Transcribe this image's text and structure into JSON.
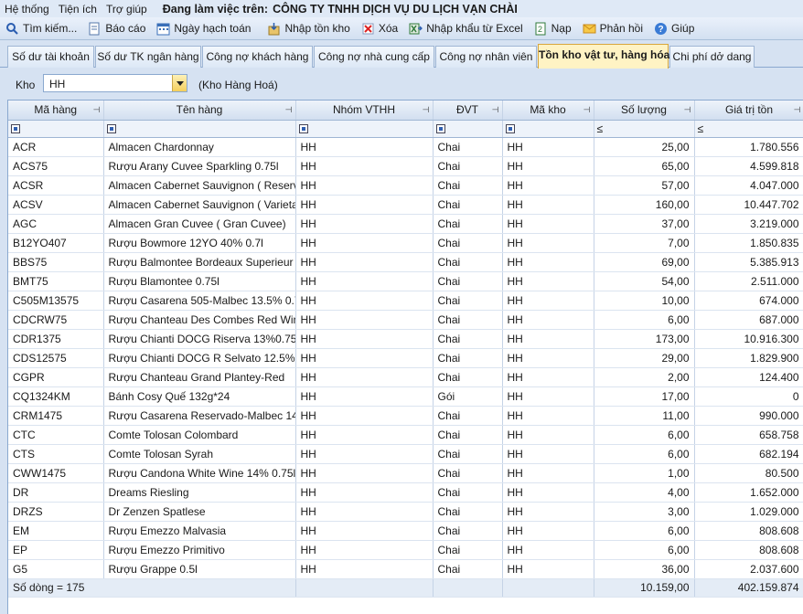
{
  "menu": [
    "Hệ thống",
    "Tiện ích",
    "Trợ giúp"
  ],
  "workspace_label": "Đang làm việc trên:",
  "company_name": "CÔNG TY TNHH DỊCH VỤ DU LỊCH VẠN CHÀI",
  "toolbar": {
    "search": "Tìm kiếm...",
    "report": "Báo cáo",
    "accounting_date": "Ngày hạch toán",
    "import_stock": "Nhập tồn kho",
    "delete": "Xóa",
    "import_excel": "Nhập khẩu từ Excel",
    "load": "Nạp",
    "feedback": "Phản hồi",
    "help": "Giúp"
  },
  "tabs": [
    "Số dư tài khoản",
    "Số dư TK ngân hàng",
    "Công nợ khách hàng",
    "Công nợ nhà cung cấp",
    "Công nợ nhân viên",
    "Tồn kho vật tư, hàng hóa",
    "Chi phí dở dang"
  ],
  "active_tab": 5,
  "filter": {
    "label": "Kho",
    "value": "HH",
    "description": "(Kho Hàng Hoá)"
  },
  "columns": [
    "Mã hàng",
    "Tên hàng",
    "Nhóm VTHH",
    "ĐVT",
    "Mã kho",
    "Số lượng",
    "Giá trị tồn"
  ],
  "filter_ops": {
    "quantity": "≤",
    "value": "≤"
  },
  "rows": [
    [
      "ACR",
      "Almacen Chardonnay",
      "HH",
      "Chai",
      "HH",
      "25,00",
      "1.780.556"
    ],
    [
      "ACS75",
      "Rượu Arany Cuvee Sparkling 0.75l",
      "HH",
      "Chai",
      "HH",
      "65,00",
      "4.599.818"
    ],
    [
      "ACSR",
      "Almacen Cabernet Sauvignon ( Reserv",
      "HH",
      "Chai",
      "HH",
      "57,00",
      "4.047.000"
    ],
    [
      "ACSV",
      "Almacen Cabernet Sauvignon ( Varietal",
      "HH",
      "Chai",
      "HH",
      "160,00",
      "10.447.702"
    ],
    [
      "AGC",
      "Almacen Gran Cuvee ( Gran Cuvee)",
      "HH",
      "Chai",
      "HH",
      "37,00",
      "3.219.000"
    ],
    [
      "B12YO407",
      "Rượu Bowmore 12YO 40% 0.7l",
      "HH",
      "Chai",
      "HH",
      "7,00",
      "1.850.835"
    ],
    [
      "BBS75",
      "Rượu Balmontee Bordeaux Superieur 0.",
      "HH",
      "Chai",
      "HH",
      "69,00",
      "5.385.913"
    ],
    [
      "BMT75",
      "Rượu Blamontee 0.75l",
      "HH",
      "Chai",
      "HH",
      "54,00",
      "2.511.000"
    ],
    [
      "C505M13575",
      "Rượu Casarena 505-Malbec 13.5% 0.7",
      "HH",
      "Chai",
      "HH",
      "10,00",
      "674.000"
    ],
    [
      "CDCRW75",
      "Rượu Chanteau Des Combes Red Wine",
      "HH",
      "Chai",
      "HH",
      "6,00",
      "687.000"
    ],
    [
      "CDR1375",
      "Rượu Chianti DOCG Riserva 13%0.75l",
      "HH",
      "Chai",
      "HH",
      "173,00",
      "10.916.300"
    ],
    [
      "CDS12575",
      "Rượu Chianti DOCG R Selvato 12.5%0.",
      "HH",
      "Chai",
      "HH",
      "29,00",
      "1.829.900"
    ],
    [
      "CGPR",
      "Rượu Chanteau Grand Plantey-Red",
      "HH",
      "Chai",
      "HH",
      "2,00",
      "124.400"
    ],
    [
      "CQ1324KM",
      "Bánh Cosy Quế 132g*24",
      "HH",
      "Gói",
      "HH",
      "17,00",
      "0"
    ],
    [
      "CRM1475",
      "Rượu Casarena Reservado-Malbec 14",
      "HH",
      "Chai",
      "HH",
      "11,00",
      "990.000"
    ],
    [
      "CTC",
      "Comte Tolosan Colombard",
      "HH",
      "Chai",
      "HH",
      "6,00",
      "658.758"
    ],
    [
      "CTS",
      "Comte Tolosan Syrah",
      "HH",
      "Chai",
      "HH",
      "6,00",
      "682.194"
    ],
    [
      "CWW1475",
      "Rượu Candona White Wine 14% 0.75l",
      "HH",
      "Chai",
      "HH",
      "1,00",
      "80.500"
    ],
    [
      "DR",
      "Dreams Riesling",
      "HH",
      "Chai",
      "HH",
      "4,00",
      "1.652.000"
    ],
    [
      "DRZS",
      "Dr Zenzen Spatlese",
      "HH",
      "Chai",
      "HH",
      "3,00",
      "1.029.000"
    ],
    [
      "EM",
      "Rượu Emezzo Malvasia",
      "HH",
      "Chai",
      "HH",
      "6,00",
      "808.608"
    ],
    [
      "EP",
      "Rượu Emezzo Primitivo",
      "HH",
      "Chai",
      "HH",
      "6,00",
      "808.608"
    ],
    [
      "G5",
      "Rượu Grappe 0.5l",
      "HH",
      "Chai",
      "HH",
      "36,00",
      "2.037.600"
    ]
  ],
  "totals": {
    "row_count": "Số dòng = 175",
    "quantity": "10.159,00",
    "value": "402.159.874"
  }
}
